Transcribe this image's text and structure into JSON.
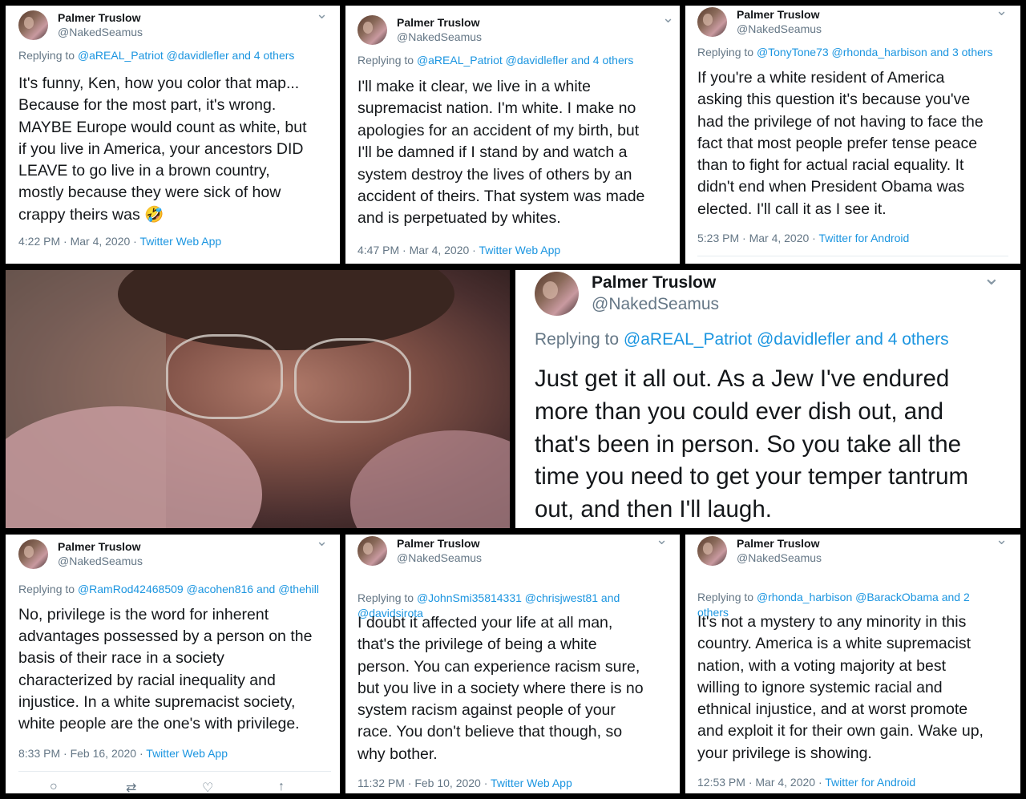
{
  "author": {
    "name": "Palmer Truslow",
    "handle": "@NakedSeamus"
  },
  "tweets": [
    {
      "replying_prefix": "Replying to ",
      "replying_to": "@aREAL_Patriot @davidlefler and 4 others",
      "text": "It's funny, Ken, how you color that map...\nBecause for the most part, it's wrong.\nMAYBE Europe would count as white, but\nif you live in America, your ancestors DID\nLEAVE to go live in a brown country,\nmostly because they were sick of how\ncrappy theirs was 🤣",
      "time": "4:22 PM · Mar 4, 2020",
      "sep": " · ",
      "source": "Twitter Web App"
    },
    {
      "replying_prefix": "Replying to ",
      "replying_to": "@aREAL_Patriot @davidlefler and 4 others",
      "text": "I'll make it clear, we live in a white\nsupremacist nation. I'm white. I make no\napologies for an accident of my birth, but\nI'll be damned if I stand by and watch a\nsystem destroy the lives of others by an\naccident of theirs. That system was made\nand is perpetuated by whites.",
      "time": "4:47 PM · Mar 4, 2020",
      "sep": " · ",
      "source": "Twitter Web App"
    },
    {
      "replying_prefix": "Replying to ",
      "replying_to": "@TonyTone73 @rhonda_harbison and 3 others",
      "text": "If you're a white resident of America\nasking this question it's because you've\nhad the privilege of not having to face the\nfact that most people prefer tense peace\nthan to fight for actual racial equality. It\ndidn't end when President Obama was\nelected. I'll call it as I see it.",
      "time": "5:23 PM · Mar 4, 2020",
      "sep": " · ",
      "source": "Twitter for Android"
    },
    {
      "replying_prefix": "Replying to ",
      "replying_to": "@aREAL_Patriot @davidlefler and 4 others",
      "text": "Just get it all out.  As a Jew I've endured\nmore than you could ever dish out, and\nthat's been in person.  So you take all the\ntime you need to get your temper tantrum\nout, and then I'll laugh."
    },
    {
      "replying_prefix": "Replying to ",
      "replying_to": "@RamRod42468509 @acohen816 and @thehill",
      "text": "No, privilege is the word for inherent\nadvantages possessed by a person on the\nbasis of their race in a society\ncharacterized by racial inequality and\ninjustice.  In a white supremacist society,\nwhite people are the one's with privilege.",
      "time": "8:33 PM · Feb 16, 2020",
      "sep": " · ",
      "source": "Twitter Web App"
    },
    {
      "replying_prefix": "Replying to ",
      "replying_to": "@JohnSmi35814331 @chrisjwest81 and\n@davidsirota",
      "text": "I doubt it affected your life at all man,\nthat's the privilege of being a white\nperson.  You can experience racism sure,\nbut you live in a society where there is no\nsystem racism against people of your\nrace.  You don't believe that though, so\nwhy bother.",
      "time": "11:32 PM · Feb 10, 2020",
      "sep": " · ",
      "source": "Twitter Web App"
    },
    {
      "replying_prefix": "Replying to ",
      "replying_to": "@rhonda_harbison @BarackObama and 2\nothers",
      "text": "It's not a mystery to any minority in this\ncountry. America is a white supremacist\nnation, with a voting majority at best\nwilling to ignore systemic racial and\nethnical injustice, and at worst promote\nand exploit it for their own gain. Wake up,\nyour privilege is showing.",
      "time": "12:53 PM · Mar 4, 2020",
      "sep": " · ",
      "source": "Twitter for Android"
    }
  ],
  "chevron": "⌄",
  "action_icons": [
    "reply-icon",
    "retweet-icon",
    "like-icon",
    "share-icon"
  ],
  "colors": {
    "link": "#1b95e0",
    "meta": "#657786",
    "text": "#14171a",
    "background": "#000000"
  }
}
